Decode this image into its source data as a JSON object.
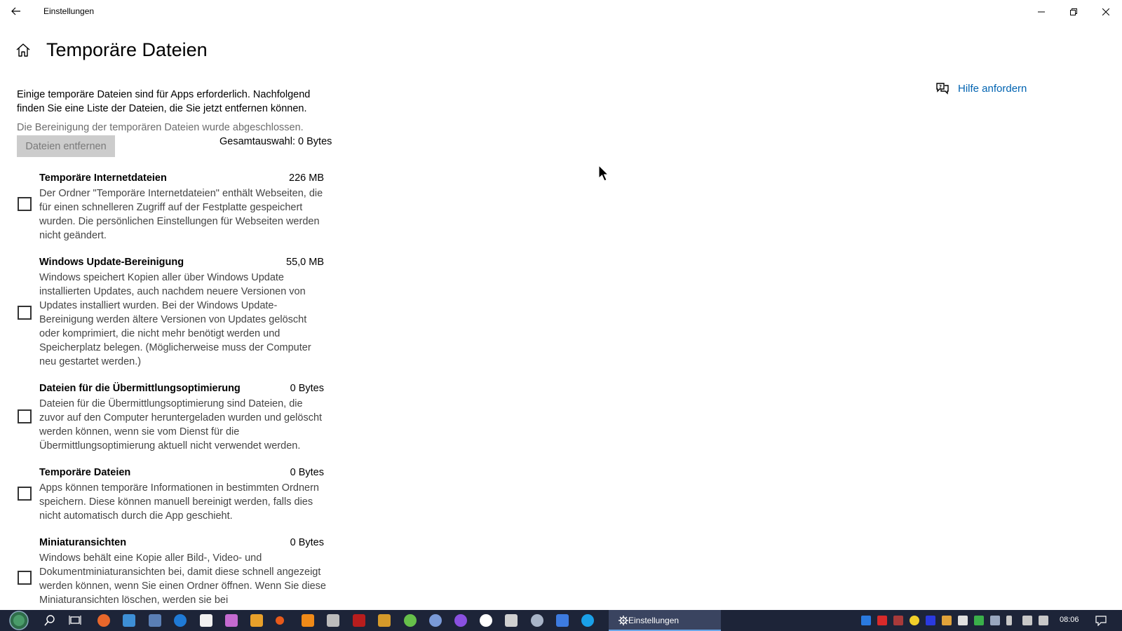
{
  "window": {
    "title": "Einstellungen",
    "back_icon": "back-arrow-icon",
    "minimize_icon": "minimize-icon",
    "maximize_icon": "restore-icon",
    "close_icon": "close-icon"
  },
  "header": {
    "home_icon": "home-icon",
    "title": "Temporäre Dateien"
  },
  "help": {
    "icon": "help-chat-icon",
    "label": "Hilfe anfordern"
  },
  "intro": "Einige temporäre Dateien sind für Apps erforderlich. Nachfolgend finden Sie eine Liste der Dateien, die Sie jetzt entfernen können.",
  "status": "Die Bereinigung der temporären Dateien wurde abgeschlossen.",
  "remove_button": "Dateien entfernen",
  "total_selection": "Gesamtauswahl: 0 Bytes",
  "items": [
    {
      "name": "Temporäre Internetdateien",
      "size": "226 MB",
      "checked": false,
      "description": "Der Ordner \"Temporäre Internetdateien\" enthält Webseiten, die für einen schnelleren Zugriff auf der Festplatte gespeichert wurden. Die persönlichen Einstellungen für Webseiten werden nicht geändert."
    },
    {
      "name": "Windows Update-Bereinigung",
      "size": "55,0 MB",
      "checked": false,
      "description": "Windows speichert Kopien aller über Windows Update installierten Updates, auch nachdem neuere Versionen von Updates installiert wurden. Bei der Windows Update-Bereinigung werden ältere Versionen von Updates gelöscht oder komprimiert, die nicht mehr benötigt werden und Speicherplatz belegen. (Möglicherweise muss der Computer neu gestartet werden.)"
    },
    {
      "name": "Dateien für die Übermittlungsoptimierung",
      "size": "0 Bytes",
      "checked": false,
      "description": "Dateien für die Übermittlungsoptimierung sind Dateien, die zuvor auf den Computer heruntergeladen wurden und gelöscht werden können, wenn sie vom Dienst für die Übermittlungsoptimierung aktuell nicht verwendet werden."
    },
    {
      "name": "Temporäre Dateien",
      "size": "0 Bytes",
      "checked": false,
      "description": "Apps können temporäre Informationen in bestimmten Ordnern speichern. Diese können manuell bereinigt werden, falls dies nicht automatisch durch die App geschieht."
    },
    {
      "name": "Miniaturansichten",
      "size": "0 Bytes",
      "checked": false,
      "description": "Windows behält eine Kopie aller Bild-, Video- und Dokumentminiaturansichten bei, damit diese schnell angezeigt werden können, wenn Sie einen Ordner öffnen. Wenn Sie diese Miniaturansichten löschen, werden sie bei"
    }
  ],
  "taskbar": {
    "active_app": "Einstellungen",
    "clock": "08:06",
    "colors": {
      "background": "#1d2438",
      "accent": "#0063b1"
    }
  }
}
